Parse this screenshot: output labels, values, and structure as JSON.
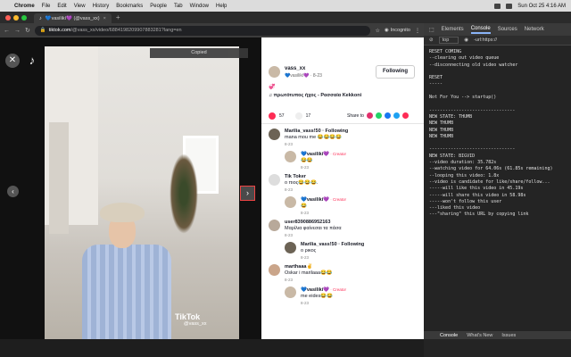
{
  "menubar": {
    "app": "Chrome",
    "items": [
      "File",
      "Edit",
      "View",
      "History",
      "Bookmarks",
      "People",
      "Tab",
      "Window",
      "Help"
    ],
    "clock": "Sun Oct 25 4:16 AM"
  },
  "tab": {
    "title": "💙vasilikí💜 (@vass_xx)",
    "close": "×",
    "new": "+"
  },
  "address": {
    "back": "←",
    "forward": "→",
    "reload": "↻",
    "url_host": "tiktok.com",
    "url_path": "/@vass_xx/video/6884198209907883281?lang=en",
    "incognito": "Incognito"
  },
  "video": {
    "toast": "Copied",
    "close": "✕",
    "prev": "‹",
    "next": "›",
    "watermark": "TikTok",
    "watermark_user": "@vass_xx"
  },
  "sidebar": {
    "author_name": "vass_xx",
    "author_sub": "💙vasilikí💜 · 8-23",
    "follow": "Following",
    "caption": "💞",
    "sound": "♫ πρωτότυπος ήχος - Ρασσαία Κekkoni",
    "likes": "57",
    "comments": "17",
    "share_label": "Share to"
  },
  "comments": [
    {
      "name": "Marilia_vass!50 · Following",
      "text": "mana mou me 😂😂😂😂",
      "meta": "8-23",
      "reply": false
    },
    {
      "name": "💙vasilikí💜",
      "tag": " · Creator",
      "text": "😂😂",
      "meta": "8-23",
      "reply": true
    },
    {
      "name": "Tik Toker",
      "text": "ο πιος😂😂😂.",
      "meta": "8-23",
      "reply": false
    },
    {
      "name": "💙vasilikí💜",
      "tag": " · Creator",
      "text": "😂",
      "meta": "8-23",
      "reply": true
    },
    {
      "name": "user8390886952163",
      "text": "Μαρίλια φαίνεσαι τα πάσα",
      "meta": "8-23",
      "reply": false
    },
    {
      "name": "Marilia_vass!50 · Following",
      "text": "ο ρικος",
      "meta": "8-23",
      "reply": true
    },
    {
      "name": "marthaaa✌",
      "text": "Oskar i marilaaa😂😂",
      "meta": "8-23",
      "reply": false
    },
    {
      "name": "💙vasilikí💜",
      "tag": " · Creator",
      "text": "me eides😂😂",
      "meta": "8-23",
      "reply": true
    }
  ],
  "devtools": {
    "tabs": [
      "Elements",
      "Console",
      "Sources",
      "Network"
    ],
    "context": "top",
    "filter": "-url:https://",
    "lines": [
      "RESET COMING",
      "--clearing out video queue",
      "--disconnecting old video watcher",
      "",
      "RESET",
      "-----",
      "",
      "Not For You --> startup()",
      "",
      "--------------------------------",
      "NEW STATE: THUMB",
      "NEW THUMB",
      "NEW THUMB",
      "NEW THUMB",
      "",
      "--------------------------------",
      "NEW STATE: BIGVID",
      "--video duration: 35.782s",
      "--watching video for 64.06s (61.85s remaining)",
      "--looping this video: 1.8x",
      "--video is candidate for like/share/follow...",
      "-----will like this video in 45.19s",
      "-----will share this video in 58.98s",
      "-----won't follow this user",
      "---liked this video",
      "---\"sharing\" this URL by copying link"
    ],
    "bottom_tabs": [
      "Console",
      "What's New",
      "Issues"
    ]
  }
}
